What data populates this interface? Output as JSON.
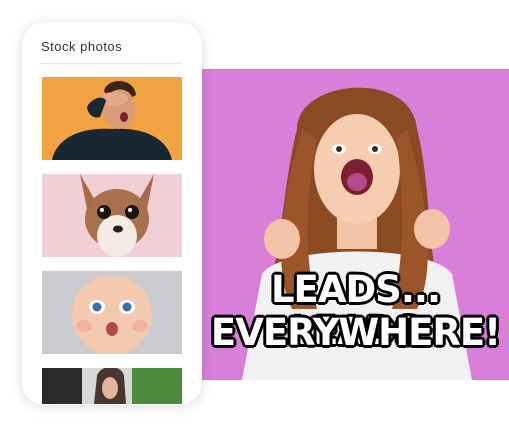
{
  "panel": {
    "title": "Stock photos",
    "thumbnails": [
      {
        "subject": "man-hiding-face-photo",
        "bg": "#f1a242"
      },
      {
        "subject": "chihuahua-dog-photo",
        "bg": "#f2cfd6"
      },
      {
        "subject": "surprised-baby-photo",
        "bg": "#c9cbce"
      },
      {
        "subject": "woman-outdoors-photo",
        "bg": "#4d8a3c"
      }
    ]
  },
  "meme": {
    "bg": "#d97fd9",
    "caption_line1": "LEADS... LEADS",
    "caption_line2": "EVERYWHERE!"
  }
}
